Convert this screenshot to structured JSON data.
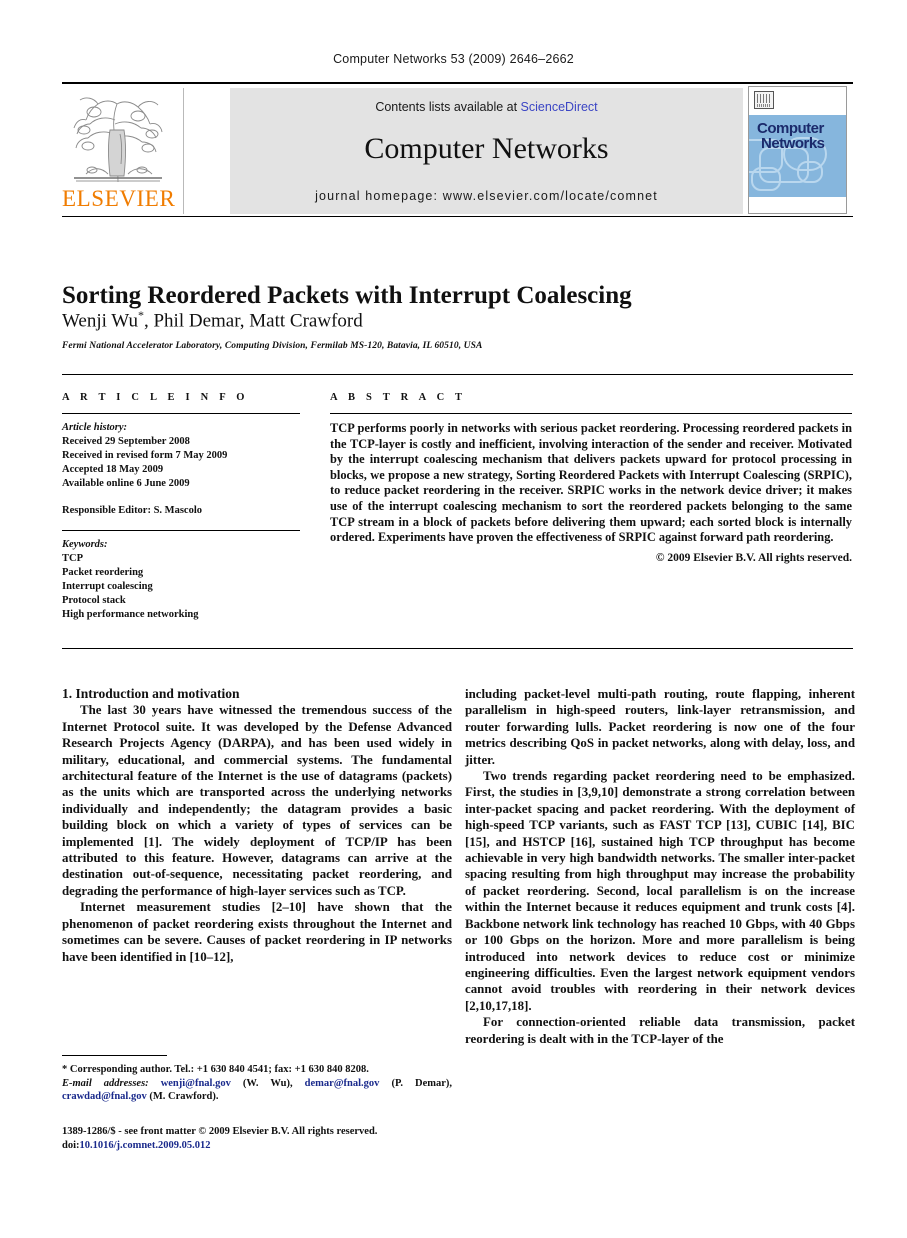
{
  "running_head": "Computer Networks 53 (2009) 2646–2662",
  "masthead": {
    "contents_prefix": "Contents lists available at ",
    "sciencedirect": "ScienceDirect",
    "journal_name": "Computer Networks",
    "homepage": "journal homepage: www.elsevier.com/locate/comnet",
    "publisher_name": "ELSEVIER",
    "cover_title_line1": "Computer",
    "cover_title_line2": "Networks",
    "link_color": "#3b45c4",
    "elsevier_orange": "#F07C00",
    "panel_gray": "#e3e3e3",
    "cover_blue": "#86b6dd"
  },
  "title": "Sorting Reordered Packets with Interrupt Coalescing",
  "authors": "Wenji Wu",
  "authors_rest": ", Phil Demar, Matt Crawford",
  "author_star": "*",
  "affiliation": "Fermi National Accelerator Laboratory, Computing Division, Fermilab MS-120, Batavia, IL 60510, USA",
  "article_info": {
    "heading": "A R T I C L E   I N F O",
    "history_label": "Article history:",
    "history": [
      "Received 29 September 2008",
      "Received in revised form 7 May 2009",
      "Accepted 18 May 2009",
      "Available online 6 June 2009"
    ],
    "editor": "Responsible Editor: S. Mascolo",
    "keywords_label": "Keywords:",
    "keywords": [
      "TCP",
      "Packet reordering",
      "Interrupt coalescing",
      "Protocol stack",
      "High performance networking"
    ]
  },
  "abstract": {
    "heading": "A B S T R A C T",
    "text": "TCP performs poorly in networks with serious packet reordering. Processing reordered packets in the TCP-layer is costly and inefficient, involving interaction of the sender and receiver. Motivated by the interrupt coalescing mechanism that delivers packets upward for protocol processing in blocks, we propose a new strategy, Sorting Reordered Packets with Interrupt Coalescing (SRPIC), to reduce packet reordering in the receiver. SRPIC works in the network device driver; it makes use of the interrupt coalescing mechanism to sort the reordered packets belonging to the same TCP stream in a block of packets before delivering them upward; each sorted block is internally ordered. Experiments have proven the effectiveness of SRPIC against forward path reordering.",
    "copyright": "© 2009 Elsevier B.V. All rights reserved."
  },
  "body": {
    "section_number_title": "1. Introduction and motivation",
    "left_paragraphs": [
      "The last 30 years have witnessed the tremendous success of the Internet Protocol suite. It was developed by the Defense Advanced Research Projects Agency (DARPA), and has been used widely in military, educational, and commercial systems. The fundamental architectural feature of the Internet is the use of datagrams (packets) as the units which are transported across the underlying networks individually and independently; the datagram provides a basic building block on which a variety of types of services can be implemented [1]. The widely deployment of TCP/IP has been attributed to this feature. However, datagrams can arrive at the destination out-of-sequence, necessitating packet reordering, and degrading the performance of high-layer services such as TCP.",
      "Internet measurement studies [2–10] have shown that the phenomenon of packet reordering exists throughout the Internet and sometimes can be severe. Causes of packet reordering in IP networks have been identified in [10–12],"
    ],
    "right_paragraphs": [
      "including packet-level multi-path routing, route flapping, inherent parallelism in high-speed routers, link-layer retransmission, and router forwarding lulls. Packet reordering is now one of the four metrics describing QoS in packet networks, along with delay, loss, and jitter.",
      "Two trends regarding packet reordering need to be emphasized. First, the studies in [3,9,10] demonstrate a strong correlation between inter-packet spacing and packet reordering. With the deployment of high-speed TCP variants, such as FAST TCP [13], CUBIC [14], BIC [15], and HSTCP [16], sustained high TCP throughput has become achievable in very high bandwidth networks. The smaller inter-packet spacing resulting from high throughput may increase the probability of packet reordering. Second, local parallelism is on the increase within the Internet because it reduces equipment and trunk costs [4]. Backbone network link technology has reached 10 Gbps, with 40 Gbps or 100 Gbps on the horizon. More and more parallelism is being introduced into network devices to reduce cost or minimize engineering difficulties. Even the largest network equipment vendors cannot avoid troubles with reordering in their network devices [2,10,17,18].",
      "For connection-oriented reliable data transmission, packet reordering is dealt with in the TCP-layer of the"
    ]
  },
  "footnotes": {
    "corresponding": "* Corresponding author. Tel.: +1 630 840 4541; fax: +1 630 840 8208.",
    "email_label": "E-mail addresses:",
    "email1": "wenji@fnal.gov",
    "email1_owner": "(W. Wu),",
    "email2": "demar@fnal.gov",
    "email2_owner": "(P. Demar),",
    "email3": "crawdad@fnal.gov",
    "email3_owner": "(M. Crawford)."
  },
  "imprint": {
    "issn_line": "1389-1286/$ - see front matter © 2009 Elsevier B.V. All rights reserved.",
    "doi_label": "doi:",
    "doi_value": "10.1016/j.comnet.2009.05.012"
  }
}
